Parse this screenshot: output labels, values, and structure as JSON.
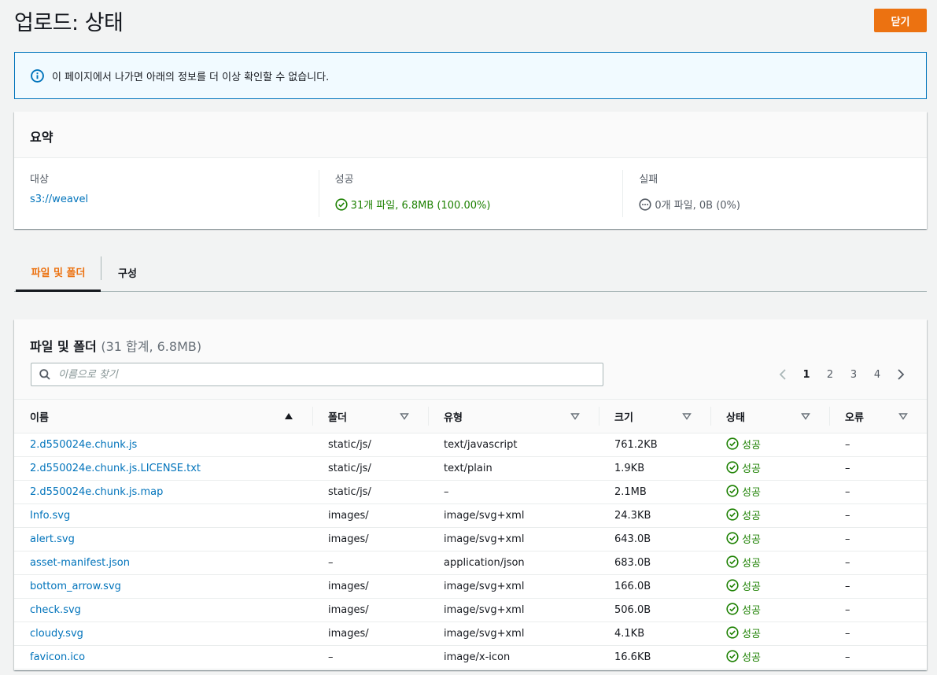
{
  "header": {
    "title": "업로드: 상태",
    "close_label": "닫기"
  },
  "banner": {
    "text": "이 페이지에서 나가면 아래의 정보를 더 이상 확인할 수 없습니다."
  },
  "summary": {
    "title": "요약",
    "target_label": "대상",
    "target_value": "s3://weavel",
    "success_label": "성공",
    "success_value": "31개 파일, 6.8MB (100.00%)",
    "failed_label": "실패",
    "failed_value": "0개 파일, 0B (0%)"
  },
  "tabs": [
    {
      "label": "파일 및 폴더",
      "active": true
    },
    {
      "label": "구성",
      "active": false
    }
  ],
  "files": {
    "title": "파일 및 폴더",
    "count": "(31 합계, 6.8MB)",
    "search_placeholder": "이름으로 찾기",
    "pages": [
      "1",
      "2",
      "3",
      "4"
    ],
    "current_page": "1",
    "columns": [
      "이름",
      "폴더",
      "유형",
      "크기",
      "상태",
      "오류"
    ],
    "rows": [
      {
        "name": "2.d550024e.chunk.js",
        "folder": "static/js/",
        "type": "text/javascript",
        "size": "761.2KB",
        "status": "성공",
        "error": "–"
      },
      {
        "name": "2.d550024e.chunk.js.LICENSE.txt",
        "folder": "static/js/",
        "type": "text/plain",
        "size": "1.9KB",
        "status": "성공",
        "error": "–"
      },
      {
        "name": "2.d550024e.chunk.js.map",
        "folder": "static/js/",
        "type": "–",
        "size": "2.1MB",
        "status": "성공",
        "error": "–"
      },
      {
        "name": "Info.svg",
        "folder": "images/",
        "type": "image/svg+xml",
        "size": "24.3KB",
        "status": "성공",
        "error": "–"
      },
      {
        "name": "alert.svg",
        "folder": "images/",
        "type": "image/svg+xml",
        "size": "643.0B",
        "status": "성공",
        "error": "–"
      },
      {
        "name": "asset-manifest.json",
        "folder": "–",
        "type": "application/json",
        "size": "683.0B",
        "status": "성공",
        "error": "–"
      },
      {
        "name": "bottom_arrow.svg",
        "folder": "images/",
        "type": "image/svg+xml",
        "size": "166.0B",
        "status": "성공",
        "error": "–"
      },
      {
        "name": "check.svg",
        "folder": "images/",
        "type": "image/svg+xml",
        "size": "506.0B",
        "status": "성공",
        "error": "–"
      },
      {
        "name": "cloudy.svg",
        "folder": "images/",
        "type": "image/svg+xml",
        "size": "4.1KB",
        "status": "성공",
        "error": "–"
      },
      {
        "name": "favicon.ico",
        "folder": "–",
        "type": "image/x-icon",
        "size": "16.6KB",
        "status": "성공",
        "error": "–"
      }
    ]
  },
  "colors": {
    "accent": "#ec7211",
    "link": "#0073bb",
    "success": "#1d8102"
  }
}
